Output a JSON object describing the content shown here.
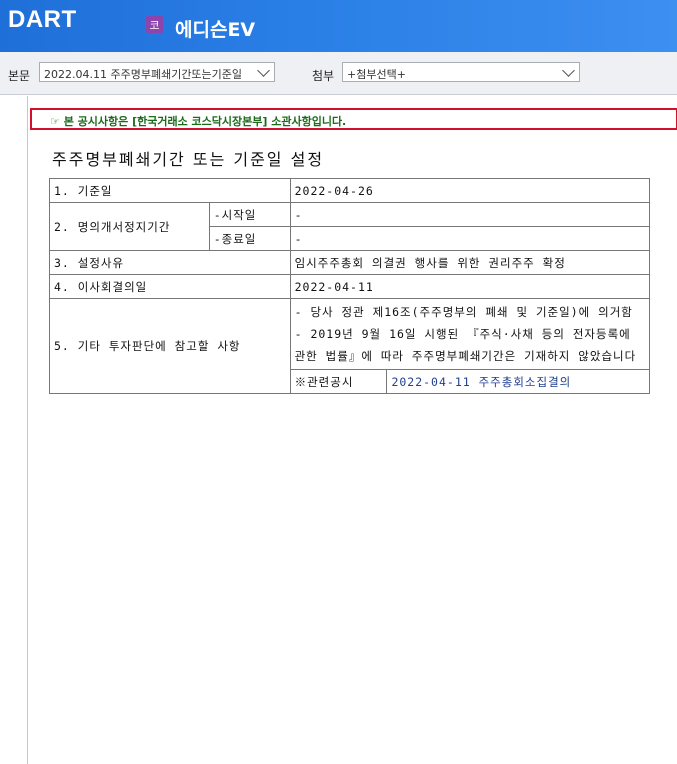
{
  "header": {
    "logo_text": "DART",
    "badge": "코",
    "company": "에디슨EV"
  },
  "toolbar": {
    "body_label": "본문",
    "body_select": "2022.04.11  주주명부폐쇄기간또는기준일",
    "attach_label": "첨부",
    "attach_select": "+첨부선택+"
  },
  "notice": "☞ 본 공시사항은 [한국거래소 코스닥시장본부] 소관사항입니다.",
  "title": "주주명부폐쇄기간 또는 기준일 설정",
  "table": {
    "row1": {
      "label": "1. 기준일",
      "value": "2022-04-26"
    },
    "row2": {
      "label": "2. 명의개서정지기간",
      "start_label": "-시작일",
      "start_value": "-",
      "end_label": "-종료일",
      "end_value": "-"
    },
    "row3": {
      "label": "3. 설정사유",
      "value": "임시주주총회 의결권 행사를 위한 권리주주 확정"
    },
    "row4": {
      "label": "4. 이사회결의일",
      "value": "2022-04-11"
    },
    "row5": {
      "label": "5. 기타 투자판단에 참고할 사항",
      "value_line1": "- 당사 정관 제16조(주주명부의 폐쇄 및 기준일)에 의거함",
      "value_line2": "- 2019년 9월 16일 시행된 『주식·사채 등의 전자등록에 관한 법률』에 따라 주주명부폐쇄기간은 기재하지 않았습니다",
      "related_label": "※관련공시",
      "related_link": "2022-04-11 주주총회소집결의"
    }
  },
  "colors": {
    "accent": "#2a7fe6",
    "notice_border": "#d0112b",
    "notice_text": "#1a6b1a",
    "link": "#1f3f8f"
  }
}
